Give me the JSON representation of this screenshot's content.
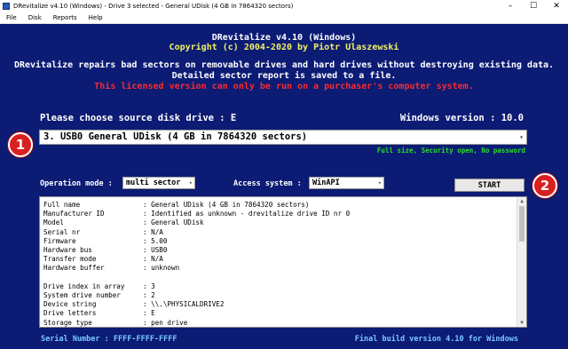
{
  "window": {
    "title": "DRevitalize v4.10 (Windows) - Drive 3 selected - General UDisk (4 GB in 7864320 sectors)",
    "controls": {
      "minimize": "–",
      "maximize": "☐",
      "close": "✕"
    }
  },
  "menu": [
    "File",
    "Disk",
    "Reports",
    "Help"
  ],
  "header": {
    "app_name": "DRevitalize v4.10 (Windows)",
    "copyright": "Copyright (c)  2004-2020  by Piotr Ulaszewski",
    "desc_line1": "DRevitalize repairs bad sectors on removable drives and hard drives without destroying existing data.",
    "desc_line2": "Detailed sector report is saved to a file.",
    "license_line": "This licensed version can only be run on a purchaser's computer system."
  },
  "source": {
    "label": "Please choose source disk drive : E",
    "windows_version": "Windows version : 10.0",
    "selected_drive": "3. USB0    General UDisk (4 GB in 7864320 sectors)",
    "drive_info": "Full size, Security open, No password"
  },
  "badges": {
    "one": "1",
    "two": "2"
  },
  "controls": {
    "operation_mode_label": "Operation mode :",
    "operation_mode_value": "multi sector",
    "access_system_label": "Access system :",
    "access_system_value": "WinAPI",
    "start_label": "START"
  },
  "info": [
    {
      "key": "Full name",
      "value": ": General UDisk (4 GB in 7864320 sectors)"
    },
    {
      "key": "Manufacturer ID",
      "value": ": Identified as unknown - drevitalize drive ID nr 0"
    },
    {
      "key": "Model",
      "value": ": General UDisk"
    },
    {
      "key": "Serial nr",
      "value": ": N/A"
    },
    {
      "key": "Firmware",
      "value": ": 5.00"
    },
    {
      "key": "Hardware bus",
      "value": ": USB0"
    },
    {
      "key": "Transfer mode",
      "value": ": N/A"
    },
    {
      "key": "Hardware buffer",
      "value": ": unknown"
    },
    {
      "key": "",
      "value": ""
    },
    {
      "key": "Drive index in array",
      "value": ": 3"
    },
    {
      "key": "System drive number",
      "value": ": 2"
    },
    {
      "key": "Device string",
      "value": ": \\\\.\\PHYSICALDRIVE2"
    },
    {
      "key": "Drive letters",
      "value": ": E"
    },
    {
      "key": "Storage type",
      "value": ": pen drive"
    }
  ],
  "footer": {
    "serial": "Serial Number : FFFF-FFFF-FFFF",
    "build": "Final build version 4.10 for Windows"
  },
  "colors": {
    "background": "#0c1b74",
    "copyright": "#f1f164",
    "license": "#ff2a2a",
    "drive_info": "#2adf2a",
    "footer": "#79c8ff",
    "badge": "#d82020"
  }
}
